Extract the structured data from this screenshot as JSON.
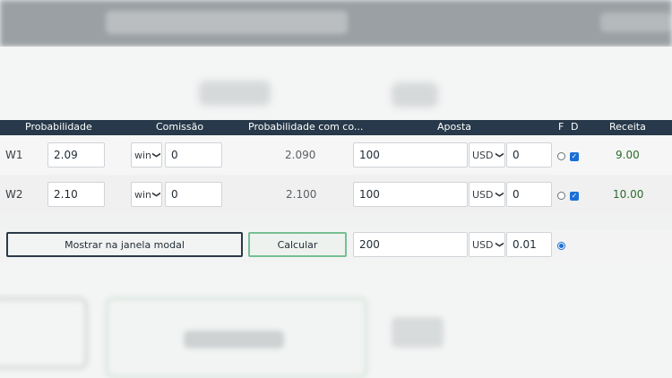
{
  "header": {
    "probabilidade": "Probabilidade",
    "comissao": "Comissão",
    "prob_com_comissao": "Probabilidade com co...",
    "aposta": "Aposta",
    "f": "F",
    "d": "D",
    "receita": "Receita"
  },
  "rows": [
    {
      "label": "W1",
      "odds": "2.09",
      "commission_type": "win",
      "commission": "0",
      "odds_with_commission": "2.090",
      "stake": "100",
      "currency": "USD",
      "rounding": "0",
      "fixed_selected": false,
      "distribute_checked": true,
      "revenue": "9.00"
    },
    {
      "label": "W2",
      "odds": "2.10",
      "commission_type": "win",
      "commission": "0",
      "odds_with_commission": "2.100",
      "stake": "100",
      "currency": "USD",
      "rounding": "0",
      "fixed_selected": false,
      "distribute_checked": true,
      "revenue": "10.00"
    }
  ],
  "footer": {
    "modal_button": "Mostrar na janela modal",
    "calc_button": "Calcular",
    "total_stake": "200",
    "currency": "USD",
    "rounding": "0.01",
    "total_fixed_selected": true
  },
  "colors": {
    "header_bg": "#27394a",
    "revenue": "#2d6a2d",
    "calc_border": "#76bf93",
    "check": "#1a6fd6"
  },
  "icons": {
    "select_arrow": "chevron-down-icon",
    "checkbox": "checkmark-icon"
  }
}
